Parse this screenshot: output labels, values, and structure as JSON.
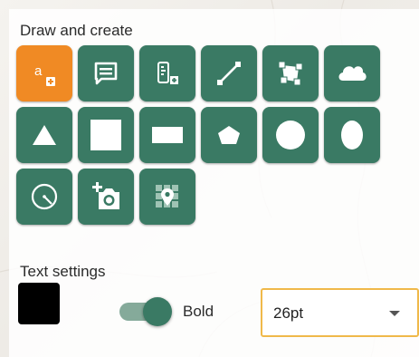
{
  "panel": {
    "draw_title": "Draw and create",
    "text_title": "Text settings"
  },
  "tools": [
    {
      "id": "text",
      "icon": "text-tool-icon",
      "glyph": "a",
      "active": true
    },
    {
      "id": "callout",
      "icon": "callout-icon",
      "active": false
    },
    {
      "id": "label",
      "icon": "label-icon",
      "active": false
    },
    {
      "id": "line",
      "icon": "line-icon",
      "active": false
    },
    {
      "id": "polygon-freehand",
      "icon": "polygon-icon",
      "active": false
    },
    {
      "id": "cloud",
      "icon": "cloud-icon",
      "active": false
    },
    {
      "id": "triangle",
      "icon": "triangle-icon",
      "active": false
    },
    {
      "id": "square",
      "icon": "square-icon",
      "active": false
    },
    {
      "id": "rectangle",
      "icon": "rectangle-icon",
      "active": false
    },
    {
      "id": "pentagon",
      "icon": "pentagon-icon",
      "active": false
    },
    {
      "id": "circle",
      "icon": "circle-icon",
      "active": false
    },
    {
      "id": "ellipse",
      "icon": "ellipse-icon",
      "active": false
    },
    {
      "id": "radius",
      "icon": "radius-icon",
      "active": false
    },
    {
      "id": "photo",
      "icon": "add-photo-icon",
      "active": false
    },
    {
      "id": "map-pin-grid",
      "icon": "map-marker-grid-icon",
      "active": false
    }
  ],
  "text_settings": {
    "color": "#000000",
    "bold_label": "Bold",
    "bold_enabled": true,
    "font_size": "26pt"
  },
  "colors": {
    "accent_green": "#3a7a64",
    "active_orange": "#f08a24",
    "select_border": "#f0b94a"
  }
}
